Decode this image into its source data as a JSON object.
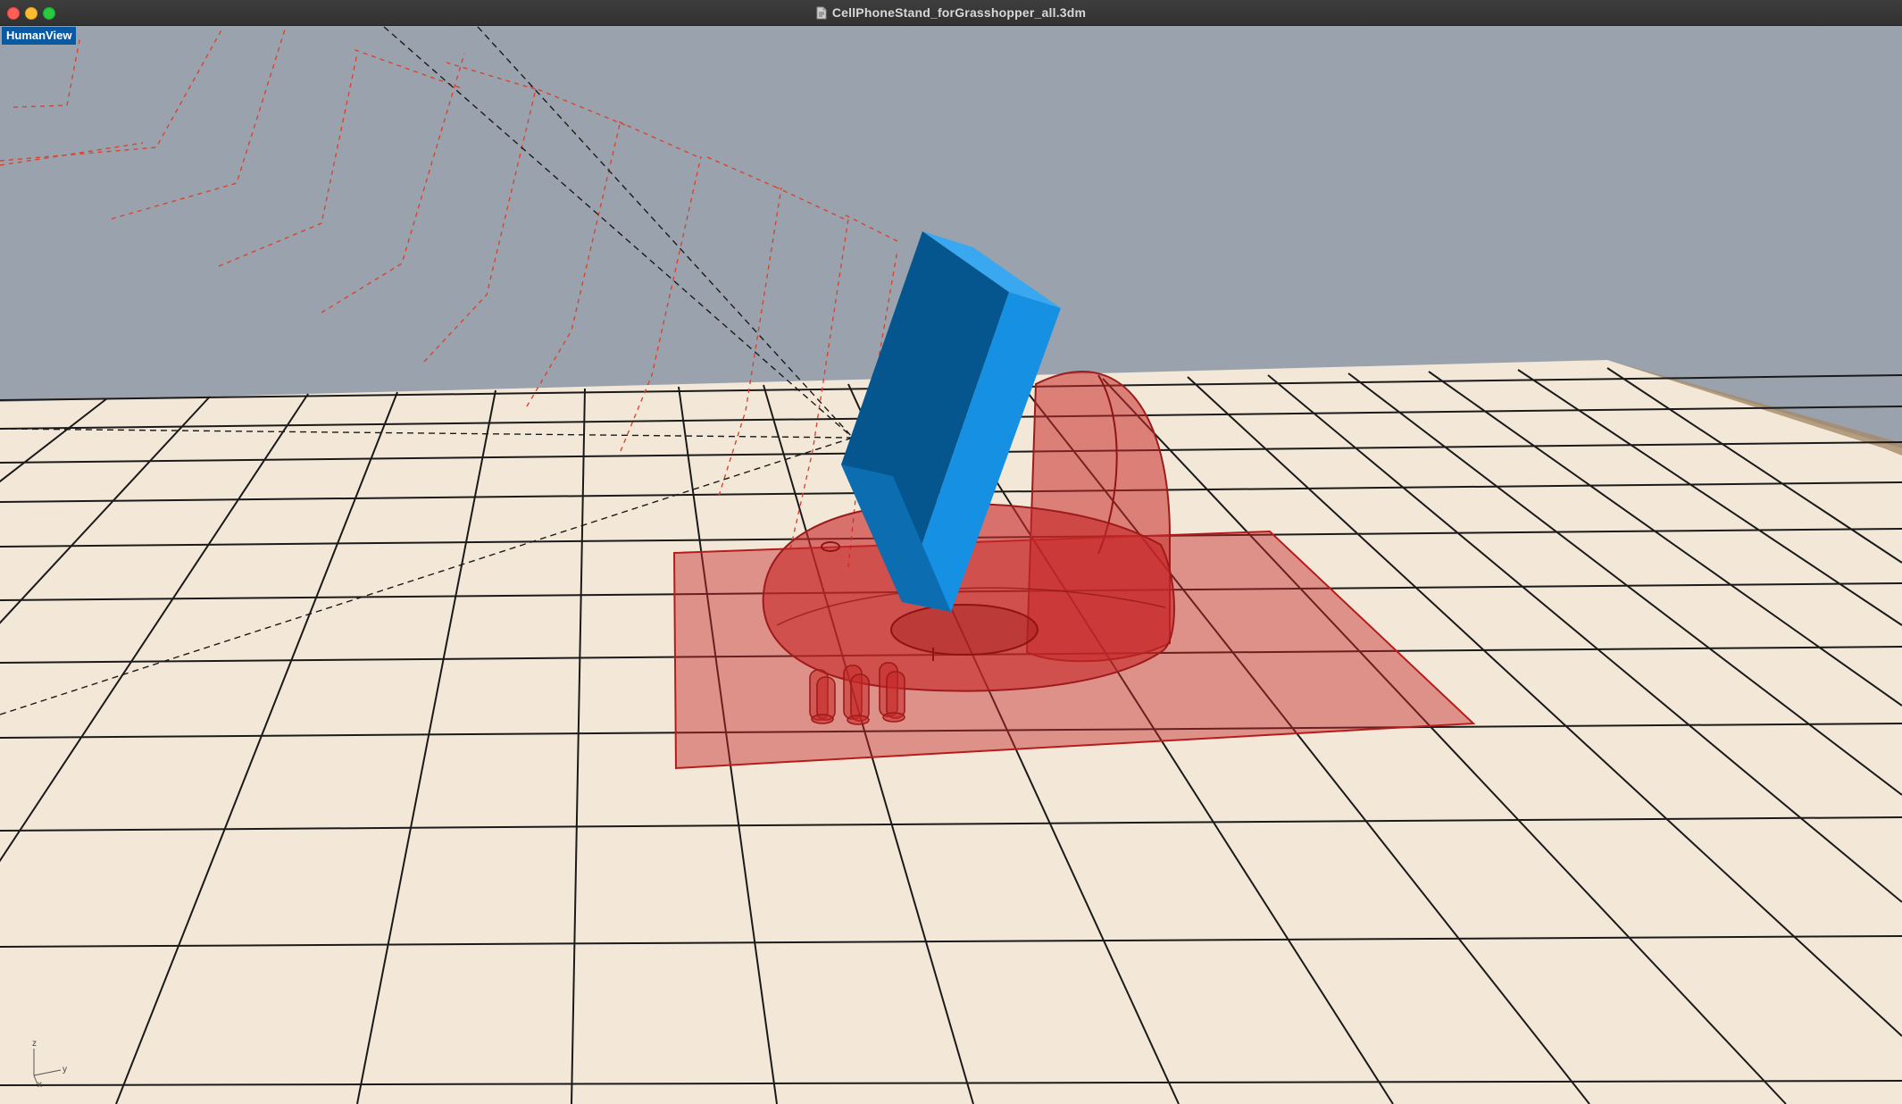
{
  "window": {
    "title": "CellPhoneStand_forGrasshopper_all.3dm",
    "document_icon": "document-icon"
  },
  "viewport": {
    "label": "HumanView",
    "background_color": "#9aa3ad",
    "grid_fill_color": "#f3e8d8",
    "grid_line_color": "#111111",
    "objects": [
      {
        "name": "phone",
        "color": "#1a8fe0"
      },
      {
        "name": "stand-body",
        "color": "#c62828"
      },
      {
        "name": "base-plate",
        "color": "#c62828"
      },
      {
        "name": "pegs",
        "color": "#c62828"
      }
    ]
  },
  "axis": {
    "z": "z",
    "x": "x",
    "y": "y"
  }
}
